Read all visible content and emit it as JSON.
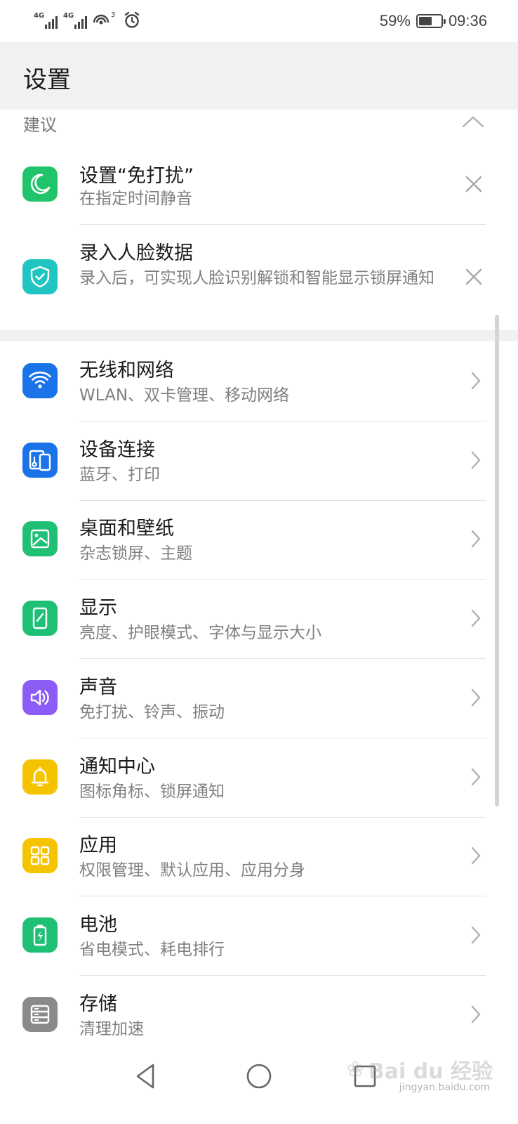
{
  "status_bar": {
    "signal_1_label": "4G",
    "signal_2_label": "4G",
    "hotspot_count": "3",
    "battery_percent": "59%",
    "battery_level": 0.59,
    "time": "09:36"
  },
  "header": {
    "title": "设置"
  },
  "suggestions": {
    "label": "建议",
    "items": [
      {
        "title": "设置“免打扰”",
        "subtitle": "在指定时间静音",
        "icon": "moon-icon",
        "color": "#20c46a"
      },
      {
        "title": "录入人脸数据",
        "subtitle": "录入后，可实现人脸识别解锁和智能显示锁屏通知",
        "icon": "shield-check-icon",
        "color": "#20c4c0"
      }
    ]
  },
  "settings": {
    "items": [
      {
        "title": "无线和网络",
        "subtitle": "WLAN、双卡管理、移动网络",
        "icon": "wifi-icon",
        "color": "#1a73e8"
      },
      {
        "title": "设备连接",
        "subtitle": "蓝牙、打印",
        "icon": "device-connect-icon",
        "color": "#1a73e8"
      },
      {
        "title": "桌面和壁纸",
        "subtitle": "杂志锁屏、主题",
        "icon": "wallpaper-icon",
        "color": "#1fbf75"
      },
      {
        "title": "显示",
        "subtitle": "亮度、护眼模式、字体与显示大小",
        "icon": "display-icon",
        "color": "#1fbf75"
      },
      {
        "title": "声音",
        "subtitle": "免打扰、铃声、振动",
        "icon": "speaker-icon",
        "color": "#8b5cf6"
      },
      {
        "title": "通知中心",
        "subtitle": "图标角标、锁屏通知",
        "icon": "bell-icon",
        "color": "#f5c400"
      },
      {
        "title": "应用",
        "subtitle": "权限管理、默认应用、应用分身",
        "icon": "apps-grid-icon",
        "color": "#f5c400"
      },
      {
        "title": "电池",
        "subtitle": "省电模式、耗电排行",
        "icon": "battery-icon",
        "color": "#1fbf75"
      },
      {
        "title": "存储",
        "subtitle": "清理加速",
        "icon": "storage-icon",
        "color": "#8a8a8a"
      }
    ]
  },
  "watermark": {
    "brand": "Bai du 经验",
    "url": "jingyan.baidu.com"
  }
}
